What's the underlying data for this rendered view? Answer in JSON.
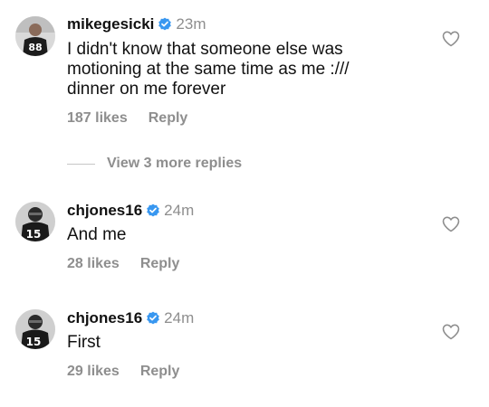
{
  "comments": [
    {
      "username": "mikegesicki",
      "time": "23m",
      "lines": [
        "I didn't know that someone else was",
        "motioning at the same time as me :///",
        "dinner on me forever"
      ],
      "likes": "187 likes",
      "reply_label": "Reply",
      "avatar_number": "88"
    },
    {
      "username": "chjones16",
      "time": "24m",
      "lines": [
        "And me"
      ],
      "likes": "28 likes",
      "reply_label": "Reply",
      "avatar_number": "15"
    },
    {
      "username": "chjones16",
      "time": "24m",
      "lines": [
        "First"
      ],
      "likes": "29 likes",
      "reply_label": "Reply",
      "avatar_number": "15"
    }
  ],
  "view_more_label": "View 3 more replies",
  "colors": {
    "verified": "#3897f0",
    "muted": "#8e8e8e",
    "text": "#111111"
  },
  "icons": {
    "verified": "verified-badge-icon",
    "like": "heart-outline-icon"
  }
}
